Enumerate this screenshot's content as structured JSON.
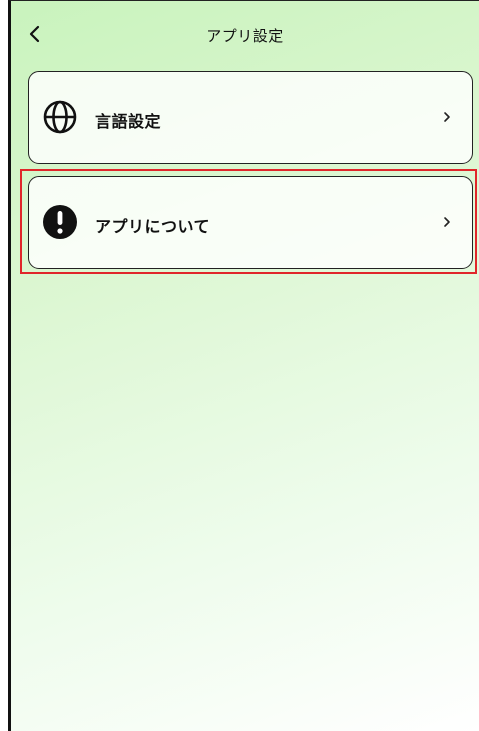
{
  "header": {
    "title": "アプリ設定",
    "back_icon": "chevron-left-icon"
  },
  "menu": {
    "items": [
      {
        "label": "言語設定",
        "icon": "globe-icon"
      },
      {
        "label": "アプリについて",
        "icon": "info-exclamation-icon"
      }
    ]
  },
  "colors": {
    "highlight": "#e0262a",
    "gradient_top": "#c9f3bd",
    "gradient_bottom": "#ffffff"
  }
}
